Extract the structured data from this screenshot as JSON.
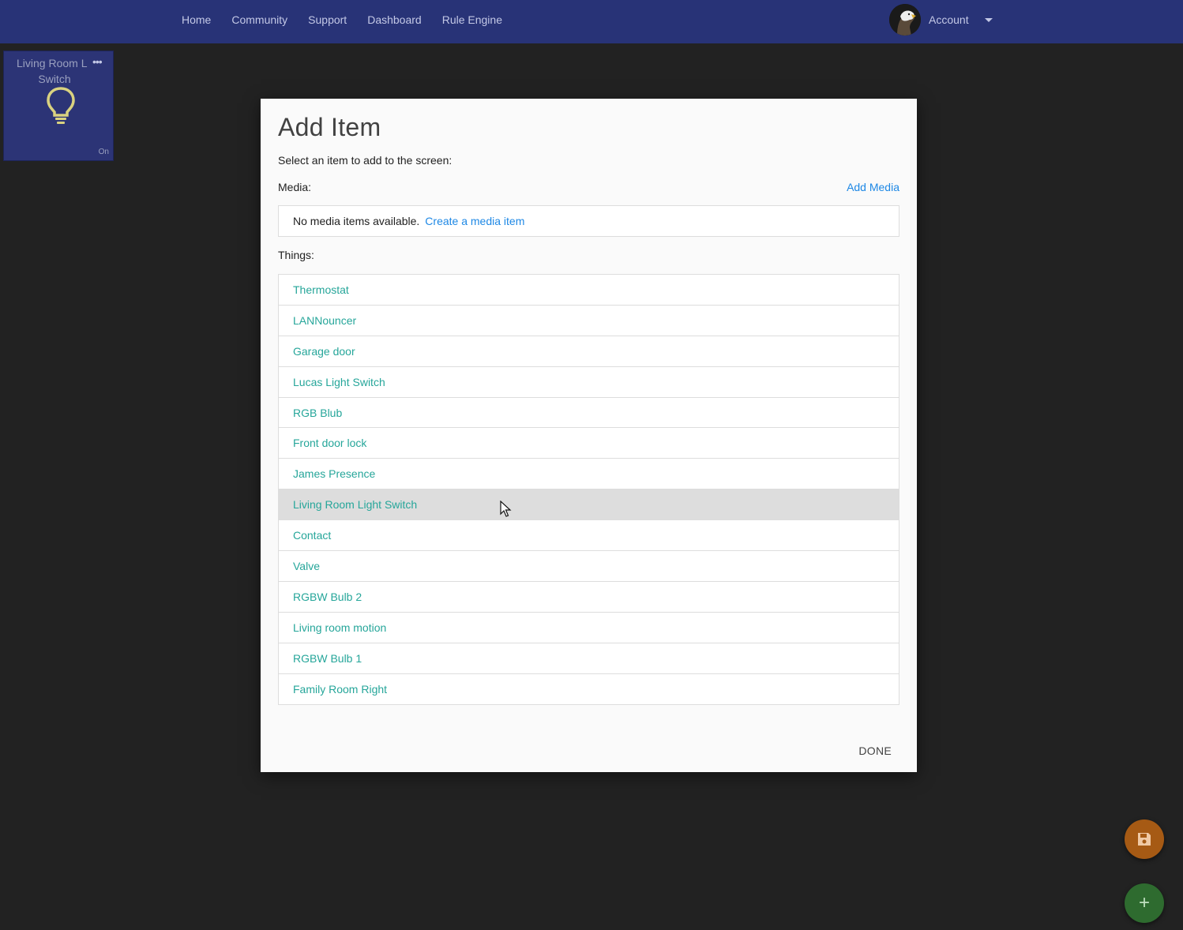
{
  "nav": {
    "links": [
      "Home",
      "Community",
      "Support",
      "Dashboard",
      "Rule Engine"
    ],
    "account_label": "Account"
  },
  "tile": {
    "title_line1": "Living Room L",
    "title_line2": "Switch",
    "menu_glyph": "•••",
    "state": "On",
    "icon": "lightbulb-icon"
  },
  "modal": {
    "title": "Add Item",
    "subtitle": "Select an item to add to the screen:",
    "media_label": "Media:",
    "add_media_label": "Add Media",
    "media_empty_text": "No media items available.",
    "media_create_link": "Create a media item",
    "things_label": "Things:",
    "things": [
      "Thermostat",
      "LANNouncer",
      "Garage door",
      "Lucas Light Switch",
      "RGB Blub",
      "Front door lock",
      "James Presence",
      "Living Room Light Switch",
      "Contact",
      "Valve",
      "RGBW Bulb 2",
      "Living room motion",
      "RGBW Bulb 1",
      "Family Room Right"
    ],
    "hovered_index": 7,
    "done_label": "DONE"
  },
  "fabs": {
    "save_icon": "save-icon",
    "add_icon": "plus-icon",
    "add_glyph": "+"
  },
  "colors": {
    "navbar": "#283377",
    "background": "#222222",
    "link_blue": "#1e88e5",
    "thing_teal": "#26a69a",
    "save_fab": "#a65a14",
    "add_fab": "#2e6b2f"
  }
}
